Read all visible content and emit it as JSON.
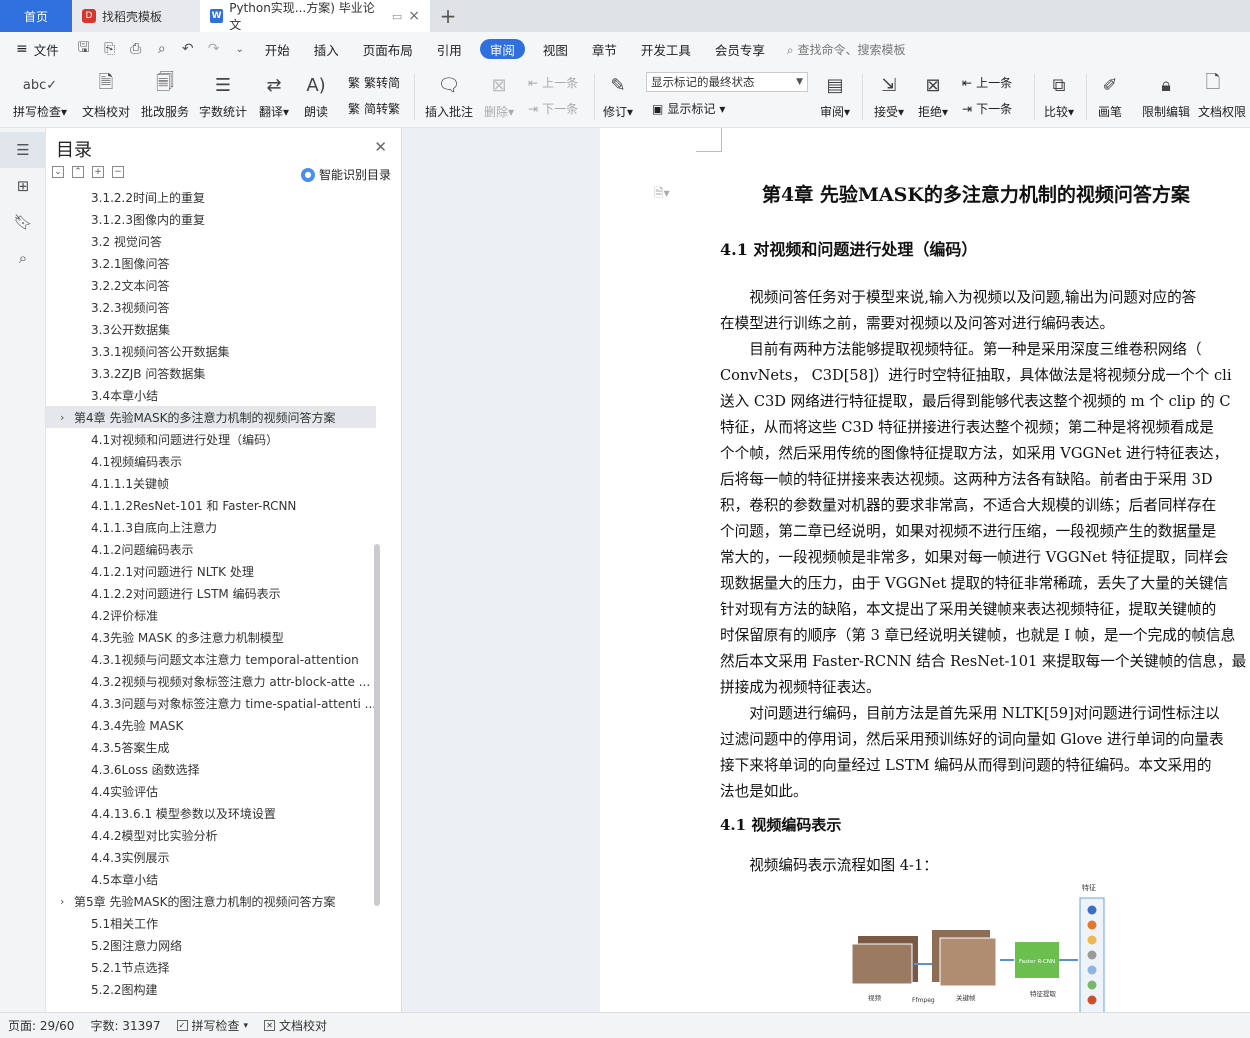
{
  "tabs": {
    "home": "首页",
    "template": "找稻壳模板",
    "document": "Python实现...方案) 毕业论文",
    "add": "+"
  },
  "menu": {
    "file": "文件",
    "items": [
      "开始",
      "插入",
      "页面布局",
      "引用",
      "审阅",
      "视图",
      "章节",
      "开发工具",
      "会员专享"
    ],
    "active": "审阅",
    "search": "查找命令、搜索模板"
  },
  "toolbar": {
    "spellcheck": "拼写检查",
    "doc_proof": "文档校对",
    "batch": "批改服务",
    "wordcount": "字数统计",
    "translate": "翻译",
    "read": "朗读",
    "trad": "繁转简",
    "simp": "简转繁",
    "insert_comment": "插入批注",
    "delete": "删除",
    "prev": "上一条",
    "next": "下一条",
    "revise": "修订",
    "markup_state": "显示标记的最终状态",
    "show_markup": "显示标记",
    "review": "审阅",
    "accept": "接受",
    "reject": "拒绝",
    "prev2": "上一条",
    "next2": "下一条",
    "compare": "比较",
    "pen": "画笔",
    "restrict": "限制编辑",
    "permission": "文档权限"
  },
  "toc": {
    "title": "目录",
    "smart": "智能识别目录",
    "items": [
      {
        "text": "3.1.2.2时间上的重复",
        "level": 2
      },
      {
        "text": "3.1.2.3图像内的重复",
        "level": 2
      },
      {
        "text": "3.2  视觉问答",
        "level": 2
      },
      {
        "text": "3.2.1图像问答",
        "level": 2
      },
      {
        "text": "3.2.2文本问答",
        "level": 2
      },
      {
        "text": "3.2.3视频问答",
        "level": 2
      },
      {
        "text": "3.3公开数据集",
        "level": 2
      },
      {
        "text": "3.3.1视频问答公开数据集",
        "level": 2
      },
      {
        "text": "3.3.2ZJB 问答数据集",
        "level": 2
      },
      {
        "text": "3.4本章小结",
        "level": 2
      },
      {
        "text": "第4章  先验MASK的多注意力机制的视频问答方案",
        "level": 1,
        "selected": true
      },
      {
        "text": "4.1对视频和问题进行处理（编码）",
        "level": 2
      },
      {
        "text": "4.1视频编码表示",
        "level": 2
      },
      {
        "text": "4.1.1.1关键帧",
        "level": 2
      },
      {
        "text": "4.1.1.2ResNet-101 和 Faster-RCNN",
        "level": 2
      },
      {
        "text": "4.1.1.3自底向上注意力",
        "level": 2
      },
      {
        "text": "4.1.2问题编码表示",
        "level": 2
      },
      {
        "text": "4.1.2.1对问题进行 NLTK 处理",
        "level": 2
      },
      {
        "text": "4.1.2.2对问题进行 LSTM 编码表示",
        "level": 2
      },
      {
        "text": "4.2评价标准",
        "level": 2
      },
      {
        "text": "4.3先验 MASK 的多注意力机制模型",
        "level": 2
      },
      {
        "text": "4.3.1视频与问题文本注意力 temporal-attention",
        "level": 2
      },
      {
        "text": "4.3.2视频与视频对象标签注意力  attr-block-atte ...",
        "level": 2
      },
      {
        "text": "4.3.3问题与对象标签注意力  time-spatial-attenti ...",
        "level": 2
      },
      {
        "text": "4.3.4先验 MASK",
        "level": 2
      },
      {
        "text": "4.3.5答案生成",
        "level": 2
      },
      {
        "text": "4.3.6Loss 函数选择",
        "level": 2
      },
      {
        "text": "4.4实验评估",
        "level": 2
      },
      {
        "text": "4.4.13.6.1  模型参数以及环境设置",
        "level": 2
      },
      {
        "text": "4.4.2模型对比实验分析",
        "level": 2
      },
      {
        "text": "4.4.3实例展示",
        "level": 2
      },
      {
        "text": "4.5本章小结",
        "level": 2
      },
      {
        "text": "第5章  先验MASK的图注意力机制的视频问答方案",
        "level": 1
      },
      {
        "text": "5.1相关工作",
        "level": 2
      },
      {
        "text": "5.2图注意力网络",
        "level": 2
      },
      {
        "text": "5.2.1节点选择",
        "level": 2
      },
      {
        "text": "5.2.2图构建",
        "level": 2
      }
    ]
  },
  "doc": {
    "chapter": "第4章  先验MASK的多注意力机制的视频问答方案",
    "h_41": "4.1   对视频和问题进行处理（编码）",
    "p1": [
      "　　视频问答任务对于模型来说,输入为视频以及问题,输出为问题对应的答",
      "在模型进行训练之前，需要对视频以及问答对进行编码表达。"
    ],
    "p2": [
      "　　目前有两种方法能够提取视频特征。第一种是采用深度三维卷积网络（",
      "ConvNets，  C3D[58]）进行时空特征抽取，具体做法是将视频分成一个个 cli",
      "送入 C3D 网络进行特征提取，最后得到能够代表这整个视频的 m 个 clip 的 C",
      "特征，从而将这些 C3D 特征拼接进行表达整个视频；第二种是将视频看成是",
      "个个帧，然后采用传统的图像特征提取方法，如采用 VGGNet 进行特征表达，",
      "后将每一帧的特征拼接来表达视频。这两种方法各有缺陷。前者由于采用 3D",
      "积，卷积的参数量对机器的要求非常高，不适合大规模的训练；后者同样存在",
      "个问题，第二章已经说明，如果对视频不进行压缩，一段视频产生的数据量是",
      "常大的，一段视频帧是非常多，如果对每一帧进行 VGGNet 特征提取，同样会",
      "现数据量大的压力，由于 VGGNet 提取的特征非常稀疏，丢失了大量的关键信",
      "针对现有方法的缺陷，本文提出了采用关键帧来表达视频特征，提取关键帧的",
      "时保留原有的顺序（第 3 章已经说明关键帧，也就是 I 帧，是一个完成的帧信息",
      "然后本文采用 Faster-RCNN 结合 ResNet-101 来提取每一个关键帧的信息，最",
      "拼接成为视频特征表达。"
    ],
    "p3": [
      "　　对问题进行编码，目前方法是首先采用 NLTK[59]对问题进行词性标注以",
      "过滤问题中的停用词，然后采用预训练好的词向量如 Glove 进行单词的向量表",
      "接下来将单词的向量经过 LSTM 编码从而得到问题的特征编码。本文采用的",
      "法也是如此。"
    ],
    "h_41b": "4.1   视频编码表示",
    "p4": "　　视频编码表示流程如图 4-1：",
    "figure": {
      "feature_label": "特征",
      "video_label": "视频",
      "ffmpeg_label": "Ffmpeg",
      "keyframe_label": "关键帧",
      "faster_label": "Faster R-CNN",
      "extract_label": "特征提取",
      "dot_colors": [
        "#3a6fc4",
        "#e2782a",
        "#f2b84a",
        "#9a9a9a",
        "#8fb4e0",
        "#79b768",
        "#c9502a"
      ]
    }
  },
  "status": {
    "page": "页面: 29/60",
    "words": "字数: 31397",
    "spell": "拼写检查",
    "proof": "文档校对"
  }
}
